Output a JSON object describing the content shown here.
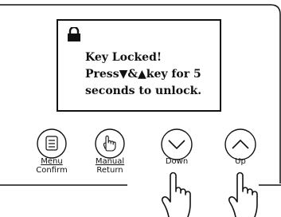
{
  "screen": {
    "line1": "Key Locked!",
    "line2": "Press▼&▲key for 5",
    "line3": "seconds to unlock."
  },
  "buttons": {
    "menu": {
      "top": "Menu",
      "bottom": "Confirm"
    },
    "manual": {
      "top": "Manual",
      "bottom": "Return"
    },
    "down": {
      "label": "Down"
    },
    "up": {
      "label": "Up"
    }
  },
  "icons": {
    "lock": "lock-icon",
    "menu": "menu-list-icon",
    "manual": "hand-pointer-icon",
    "down": "chevron-down-icon",
    "up": "chevron-up-icon",
    "press": "pressing-hand-icon"
  }
}
